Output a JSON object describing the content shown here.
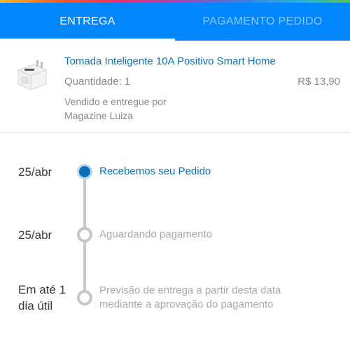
{
  "tabs": [
    {
      "label": "ENTREGA",
      "active": true
    },
    {
      "label": "PAGAMENTO PEDIDO",
      "active": false
    }
  ],
  "product": {
    "image_icon": "smart-plug-image",
    "title": "Tomada Inteligente 10A Positivo Smart Home",
    "quantity": "Quantidade: 1",
    "price": "R$ 13,90",
    "seller_line1": "Vendido e entregue por",
    "seller_line2": "Magazine Luiza"
  },
  "timeline": [
    {
      "date": "25/abr",
      "status": "Recebemos seu Pedido",
      "state": "active"
    },
    {
      "date": "25/abr",
      "status": "Aguardando pagamento",
      "state": "pending"
    },
    {
      "date_line1": "Em até 1",
      "date_line2": "dia útil",
      "status_line1": "Previsão de entrega a partir desta data",
      "status_line2": "mediante a aprovação do pagamento",
      "state": "pending"
    }
  ],
  "colors": {
    "primary": "#0086ff",
    "link": "#0f72b8",
    "muted": "#8a8a8a"
  }
}
